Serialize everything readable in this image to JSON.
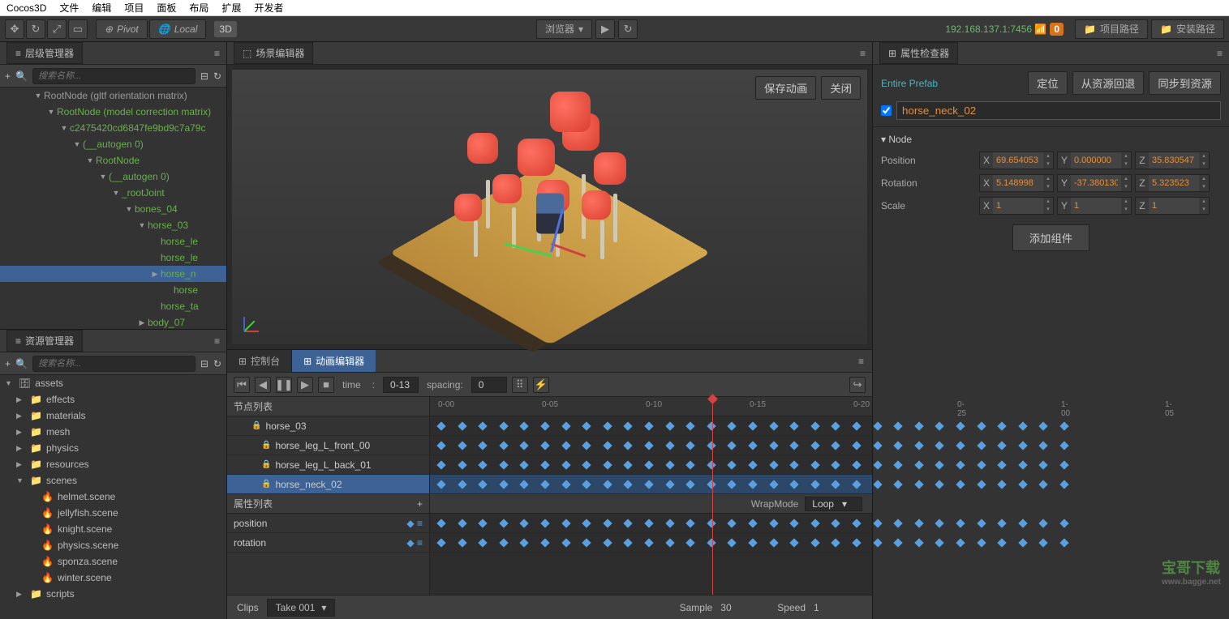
{
  "app_name": "Cocos3D",
  "menu": [
    "文件",
    "编辑",
    "项目",
    "面板",
    "布局",
    "扩展",
    "开发者"
  ],
  "topbar": {
    "pivot": "Pivot",
    "local": "Local",
    "mode": "3D",
    "preview": "浏览器",
    "ip": "192.168.137.1:7456",
    "ip_badge": "0",
    "project_path": "项目路径",
    "install_path": "安装路径"
  },
  "hierarchy": {
    "title": "层级管理器",
    "search_placeholder": "搜索名称...",
    "nodes": [
      {
        "text": "RootNode (gltf orientation matrix)",
        "indent": 5,
        "arrow": true,
        "dim": true
      },
      {
        "text": "RootNode (model correction matrix)",
        "indent": 7,
        "arrow": true
      },
      {
        "text": "c2475420cd6847fe9bd9c7a79c",
        "indent": 9,
        "arrow": true
      },
      {
        "text": "(__autogen 0)",
        "indent": 11,
        "arrow": true
      },
      {
        "text": "RootNode",
        "indent": 13,
        "arrow": true
      },
      {
        "text": "(__autogen 0)",
        "indent": 15,
        "arrow": true
      },
      {
        "text": "_rootJoint",
        "indent": 17,
        "arrow": true
      },
      {
        "text": "bones_04",
        "indent": 19,
        "arrow": true
      },
      {
        "text": "horse_03",
        "indent": 21,
        "arrow": true
      },
      {
        "text": "horse_le",
        "indent": 23,
        "arrow": false
      },
      {
        "text": "horse_le",
        "indent": 23,
        "arrow": false
      },
      {
        "text": "horse_n",
        "indent": 23,
        "arrow": "r",
        "sel": true
      },
      {
        "text": "horse",
        "indent": 25,
        "arrow": false
      },
      {
        "text": "horse_ta",
        "indent": 23,
        "arrow": false
      },
      {
        "text": "body_07",
        "indent": 21,
        "arrow": "r"
      }
    ]
  },
  "assets": {
    "title": "资源管理器",
    "search_placeholder": "搜索名称...",
    "root": "assets",
    "folders": [
      "effects",
      "materials",
      "mesh",
      "physics",
      "resources"
    ],
    "scenes_folder": "scenes",
    "scenes": [
      "helmet.scene",
      "jellyfish.scene",
      "knight.scene",
      "physics.scene",
      "sponza.scene",
      "winter.scene"
    ],
    "scripts_folder": "scripts"
  },
  "scene": {
    "title": "场景编辑器",
    "save_anim": "保存动画",
    "close": "关闭"
  },
  "inspector": {
    "title": "属性检查器",
    "entire": "Entire Prefab",
    "locate": "定位",
    "revert": "从资源回退",
    "apply": "同步到资源",
    "node_name": "horse_neck_02",
    "node_header": "Node",
    "labels": {
      "position": "Position",
      "rotation": "Rotation",
      "scale": "Scale"
    },
    "position": {
      "x": "69.654053",
      "y": "0.000000",
      "z": "35.830547"
    },
    "rotation": {
      "x": "5.148998",
      "y": "-37.380130",
      "z": "5.323523"
    },
    "scale": {
      "x": "1",
      "y": "1",
      "z": "1"
    },
    "add_component": "添加组件"
  },
  "animation": {
    "console_tab": "控制台",
    "anim_tab": "动画编辑器",
    "time_label": "time",
    "time_value": "0-13",
    "spacing_label": "spacing:",
    "spacing_value": "0",
    "node_list_header": "节点列表",
    "prop_list_header": "属性列表",
    "nodes": [
      {
        "name": "horse_03",
        "sel": false,
        "indent": 0
      },
      {
        "name": "horse_leg_L_front_00",
        "sel": false,
        "indent": 1
      },
      {
        "name": "horse_leg_L_back_01",
        "sel": false,
        "indent": 1
      },
      {
        "name": "horse_neck_02",
        "sel": true,
        "indent": 1
      }
    ],
    "props": [
      "position",
      "rotation"
    ],
    "wrapmode_label": "WrapMode",
    "wrapmode": "Loop",
    "ruler": [
      "0-00",
      "0-05",
      "0-10",
      "0-15",
      "0-20",
      "0-25",
      "1-00",
      "1-05"
    ],
    "clips_label": "Clips",
    "clip": "Take 001",
    "sample_label": "Sample",
    "sample": "30",
    "speed_label": "Speed",
    "speed": "1"
  }
}
